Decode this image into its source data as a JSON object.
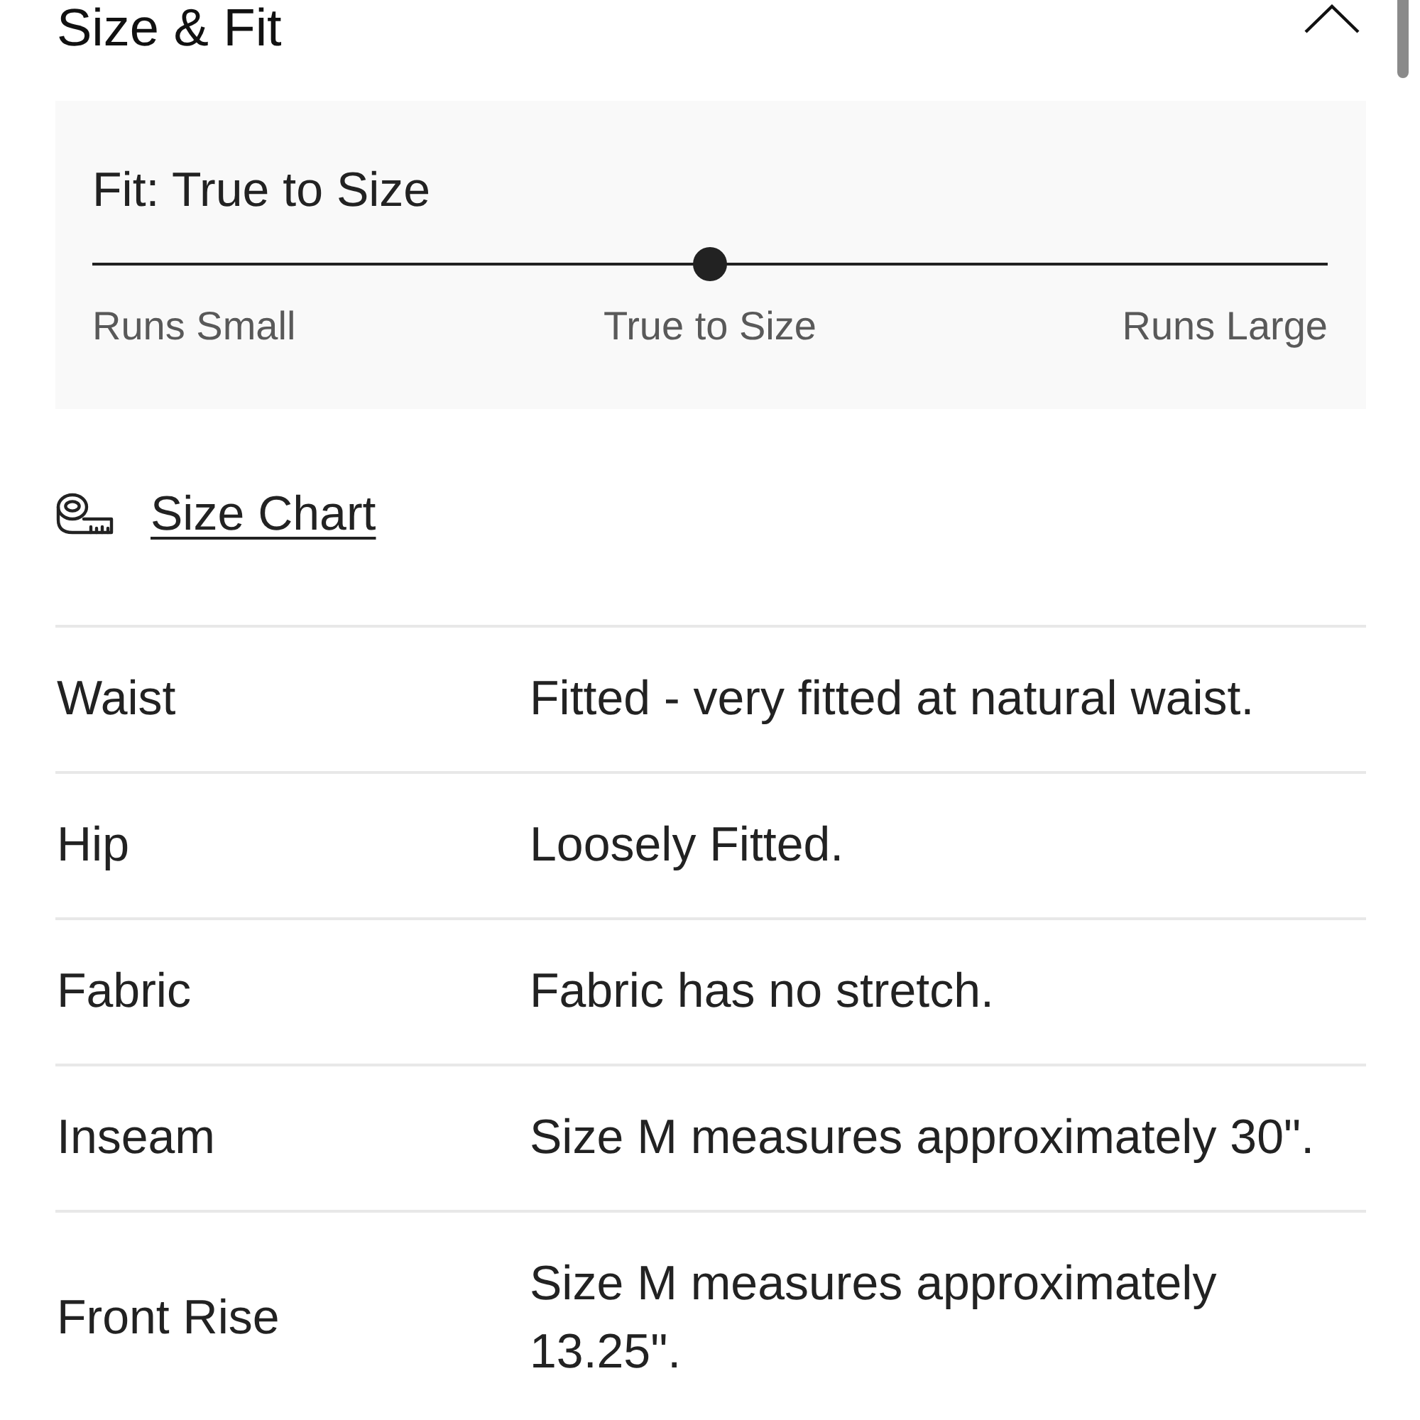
{
  "section": {
    "title": "Size & Fit",
    "expanded": true
  },
  "fit": {
    "title": "Fit: True to Size",
    "level": 0.5,
    "scale_labels": [
      "Runs Small",
      "True to Size",
      "Runs Large"
    ]
  },
  "size_chart_link": {
    "label": "Size Chart"
  },
  "details": [
    {
      "label": "Waist",
      "value": "Fitted - very fitted at natural waist."
    },
    {
      "label": "Hip",
      "value": "Loosely Fitted."
    },
    {
      "label": "Fabric",
      "value": "Fabric has no stretch."
    },
    {
      "label": "Inseam",
      "value": "Size M measures approximately 30\"."
    },
    {
      "label": "Front Rise",
      "value": "Size M measures approximately 13.25\"."
    }
  ]
}
